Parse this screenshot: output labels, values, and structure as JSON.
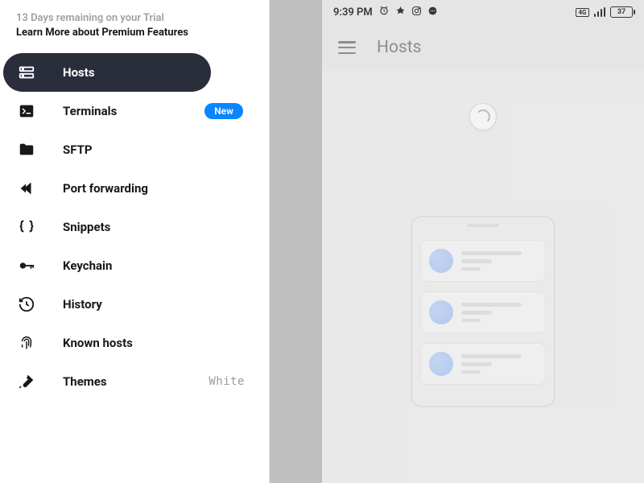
{
  "trial": {
    "line1": "13 Days remaining on your Trial",
    "line2": "Learn More about Premium Features"
  },
  "nav": {
    "items": [
      {
        "label": "Hosts"
      },
      {
        "label": "Terminals",
        "badge": "New"
      },
      {
        "label": "SFTP"
      },
      {
        "label": "Port forwarding"
      },
      {
        "label": "Snippets"
      },
      {
        "label": "Keychain"
      },
      {
        "label": "History"
      },
      {
        "label": "Known hosts"
      },
      {
        "label": "Themes",
        "trail": "White"
      }
    ]
  },
  "phone": {
    "status": {
      "time": "9:39 PM",
      "battery": "37"
    },
    "header": {
      "title": "Hosts"
    }
  }
}
